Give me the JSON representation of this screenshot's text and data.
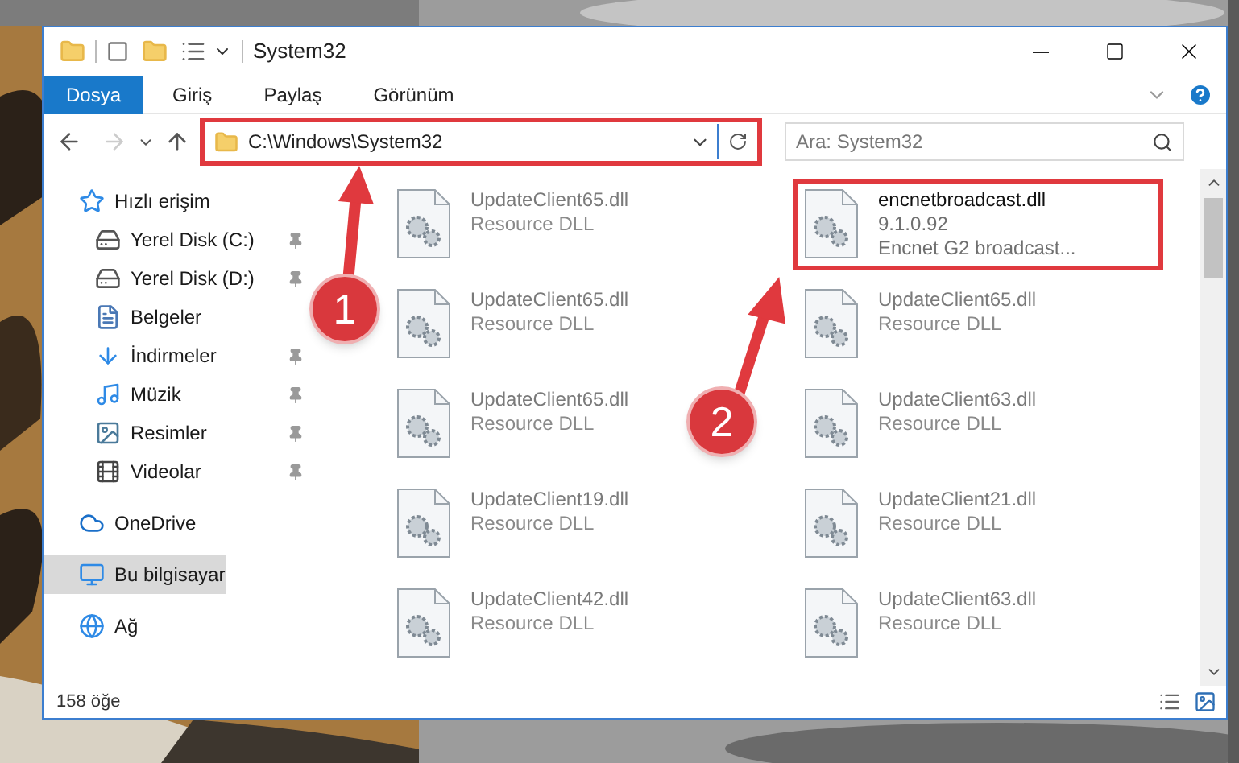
{
  "window": {
    "title": "System32"
  },
  "ribbon_tabs": [
    {
      "label": "Dosya",
      "selected": true
    },
    {
      "label": "Giriş",
      "selected": false
    },
    {
      "label": "Paylaş",
      "selected": false
    },
    {
      "label": "Görünüm",
      "selected": false
    }
  ],
  "address_bar": {
    "path": "C:\\Windows\\System32",
    "highlighted": true
  },
  "search": {
    "placeholder": "Ara: System32"
  },
  "sidebar": {
    "items": [
      {
        "label": "Hızlı erişim",
        "kind": "star",
        "selected": false,
        "children": [
          {
            "label": "Yerel Disk (C:)",
            "kind": "drive",
            "pinned": true,
            "selected": false
          },
          {
            "label": "Yerel Disk (D:)",
            "kind": "drive",
            "pinned": true,
            "selected": false
          },
          {
            "label": "Belgeler",
            "kind": "docs",
            "pinned": false,
            "selected": false
          },
          {
            "label": "İndirmeler",
            "kind": "download",
            "pinned": true,
            "selected": false
          },
          {
            "label": "Müzik",
            "kind": "music",
            "pinned": true,
            "selected": false
          },
          {
            "label": "Resimler",
            "kind": "pictures",
            "pinned": true,
            "selected": false
          },
          {
            "label": "Videolar",
            "kind": "videos",
            "pinned": true,
            "selected": false
          }
        ]
      },
      {
        "label": "OneDrive",
        "kind": "cloud",
        "selected": false
      },
      {
        "label": "Bu bilgisayar",
        "kind": "pc",
        "selected": true
      },
      {
        "label": "Ağ",
        "kind": "network",
        "selected": false
      }
    ]
  },
  "files": [
    {
      "name": "UpdateClient65.dll",
      "lines": [
        "Resource DLL"
      ],
      "highlighted": false
    },
    {
      "name": "encnetbroadcast.dll",
      "lines": [
        "9.1.0.92",
        "Encnet G2 broadcast..."
      ],
      "highlighted": true
    },
    {
      "name": "UpdateClient65.dll",
      "lines": [
        "Resource DLL"
      ],
      "highlighted": false
    },
    {
      "name": "UpdateClient65.dll",
      "lines": [
        "Resource DLL"
      ],
      "highlighted": false
    },
    {
      "name": "UpdateClient65.dll",
      "lines": [
        "Resource DLL"
      ],
      "highlighted": false
    },
    {
      "name": "UpdateClient63.dll",
      "lines": [
        "Resource DLL"
      ],
      "highlighted": false
    },
    {
      "name": "UpdateClient19.dll",
      "lines": [
        "Resource DLL"
      ],
      "highlighted": false
    },
    {
      "name": "UpdateClient21.dll",
      "lines": [
        "Resource DLL"
      ],
      "highlighted": false
    },
    {
      "name": "UpdateClient42.dll",
      "lines": [
        "Resource DLL"
      ],
      "highlighted": false
    },
    {
      "name": "UpdateClient63.dll",
      "lines": [
        "Resource DLL"
      ],
      "highlighted": false
    }
  ],
  "status_bar": {
    "count": "158 öğe"
  },
  "annotations": [
    {
      "label": "1"
    },
    {
      "label": "2"
    }
  ]
}
